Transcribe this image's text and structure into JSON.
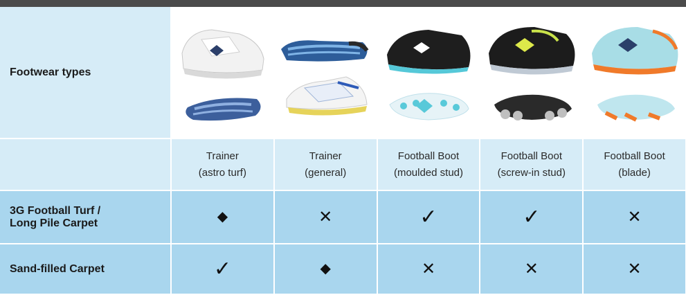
{
  "header": {
    "row_label": "Footwear types"
  },
  "shoes": [
    {
      "icon": "trainer-astro-turf-image",
      "name": "Trainer",
      "detail": "(astro turf)"
    },
    {
      "icon": "trainer-general-image",
      "name": "Trainer",
      "detail": "(general)"
    },
    {
      "icon": "football-boot-moulded-stud-image",
      "name": "Football Boot",
      "detail": "(moulded stud)"
    },
    {
      "icon": "football-boot-screw-in-stud-image",
      "name": "Football Boot",
      "detail": "(screw-in stud)"
    },
    {
      "icon": "football-boot-blade-image",
      "name": "Football Boot",
      "detail": "(blade)"
    }
  ],
  "surfaces": [
    {
      "label_line1": "3G Football Turf /",
      "label_line2": "Long Pile Carpet",
      "marks": [
        "◆",
        "✕",
        "✓",
        "✓",
        "✕"
      ]
    },
    {
      "label_line1": "Sand-filled Carpet",
      "label_line2": "",
      "marks": [
        "✓",
        "◆",
        "✕",
        "✕",
        "✕"
      ]
    }
  ],
  "colors": {
    "header_bar": "#4b4b4b",
    "light_blue": "#d6ecf7",
    "mid_blue": "#a9d6ee"
  }
}
